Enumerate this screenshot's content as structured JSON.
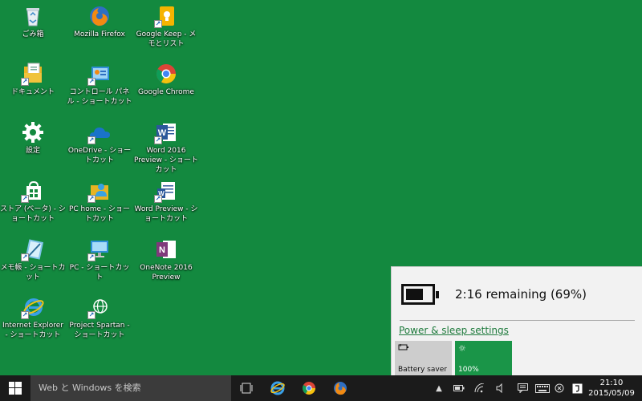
{
  "desktop": {
    "icons": [
      {
        "label": "ごみ箱"
      },
      {
        "label": "Mozilla Firefox"
      },
      {
        "label": "Google Keep - メモとリスト"
      },
      {
        "label": "ドキュメント"
      },
      {
        "label": "コントロール パネル - ショートカット"
      },
      {
        "label": "Google Chrome"
      },
      {
        "label": "設定"
      },
      {
        "label": "OneDrive - ショートカット"
      },
      {
        "label": "Word 2016 Preview - ショートカット"
      },
      {
        "label": "ストア (ベータ) - ショートカット"
      },
      {
        "label": "PC home - ショートカット"
      },
      {
        "label": "Word Preview - ショートカット"
      },
      {
        "label": "メモ帳 - ショートカット"
      },
      {
        "label": "PC - ショートカット"
      },
      {
        "label": "OneNote 2016 Preview"
      },
      {
        "label": "Internet Explorer - ショートカット"
      },
      {
        "label": "Project Spartan - ショートカット"
      }
    ]
  },
  "battery_flyout": {
    "remaining": "2:16 remaining (69%)",
    "level_percent": 69,
    "power_link": "Power & sleep settings",
    "tiles": [
      {
        "label": "Battery saver",
        "icon": "battery-saver-icon"
      },
      {
        "label": "100%",
        "icon": "brightness-icon"
      }
    ]
  },
  "taskbar": {
    "search_placeholder": "Web と Windows を検索",
    "pinned": [
      "task-view-icon",
      "edge-icon",
      "chrome-icon",
      "firefox-icon"
    ],
    "clock_time": "21:10",
    "clock_date": "2015/05/09"
  },
  "colors": {
    "desktop": "#13893f",
    "taskbar": "#1b1b1b",
    "accent": "#1a9548"
  }
}
